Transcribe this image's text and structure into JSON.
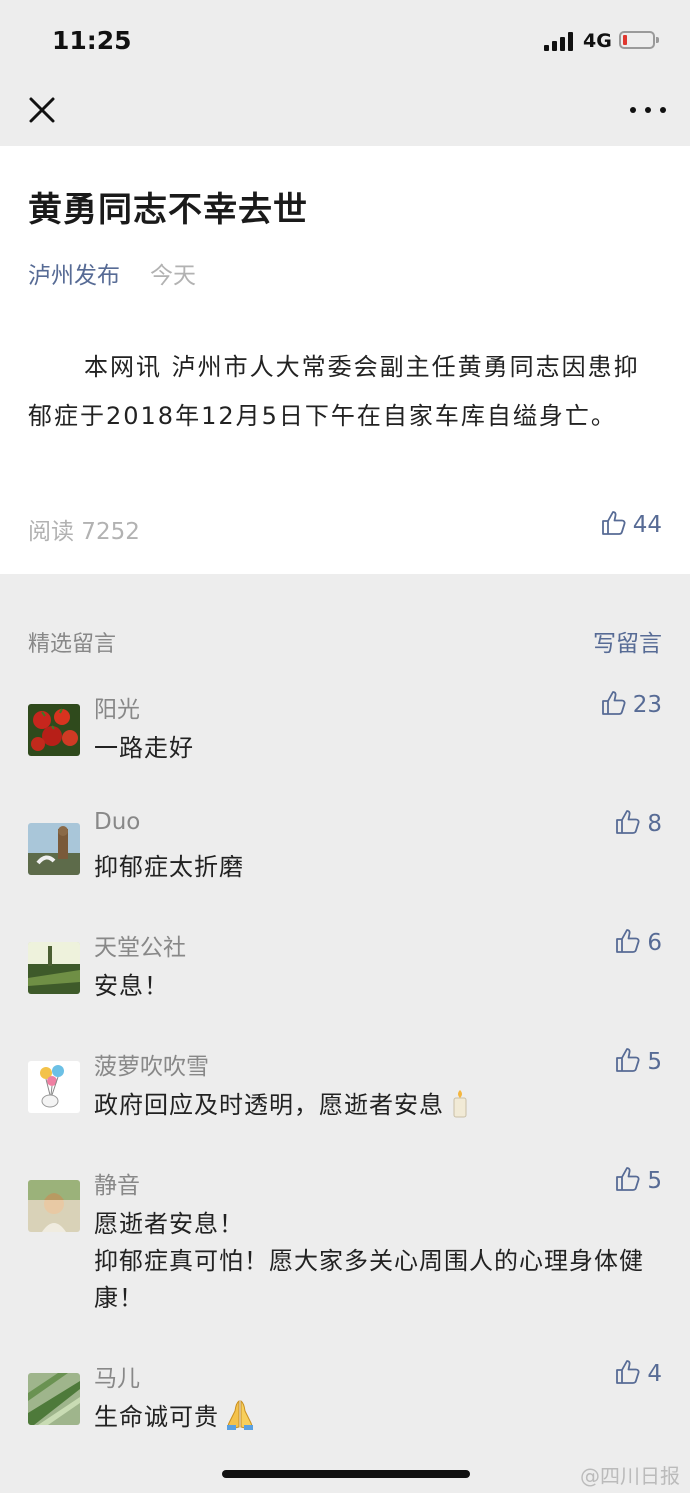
{
  "status": {
    "time": "11:25",
    "network": "4G"
  },
  "nav": {
    "close_icon": "close-icon",
    "more_icon": "more-icon"
  },
  "article": {
    "title": "黄勇同志不幸去世",
    "author": "泸州发布",
    "date": "今天",
    "body": "本网讯 泸州市人大常委会副主任黄勇同志因患抑郁症于2018年12月5日下午在自家车库自缢身亡。",
    "reads": "阅读 7252",
    "likes": "44"
  },
  "comments_section": {
    "label": "精选留言",
    "write": "写留言",
    "items": [
      {
        "name": "阳光",
        "text": "一路走好",
        "likes": "23",
        "avatar": "tomatoes"
      },
      {
        "name": "Duo",
        "text": "抑郁症太折磨",
        "likes": "8",
        "avatar": "figure"
      },
      {
        "name": "天堂公社",
        "text": "安息！",
        "likes": "6",
        "avatar": "landscape"
      },
      {
        "name": "菠萝吹吹雪",
        "text": "政府回应及时透明，愿逝者安息",
        "likes": "5",
        "avatar": "balloons",
        "emoji": "candle"
      },
      {
        "name": "静音",
        "text": "愿逝者安息！",
        "text2": "抑郁症真可怕！愿大家多关心周围人的心理身体健康！",
        "likes": "5",
        "avatar": "portrait"
      },
      {
        "name": "马儿",
        "text": "生命诚可贵",
        "likes": "4",
        "avatar": "grass",
        "emoji": "folded-hands"
      }
    ]
  },
  "watermark": "@四川日报",
  "colors": {
    "link": "#576b95",
    "muted": "#b2b2b2",
    "background": "#ededed"
  }
}
